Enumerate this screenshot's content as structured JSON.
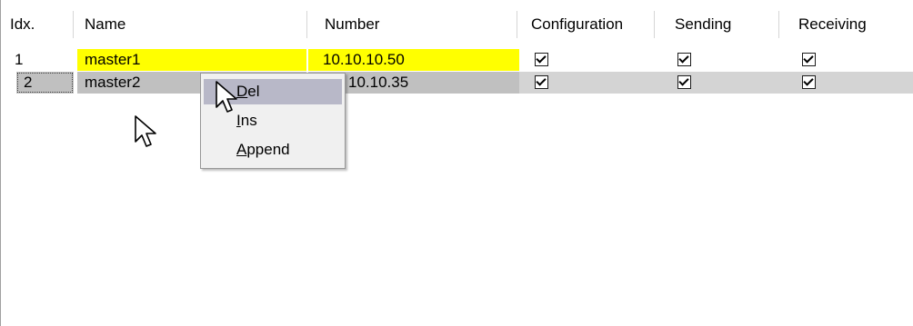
{
  "table": {
    "columns": {
      "idx": "Idx.",
      "name": "Name",
      "number": "Number",
      "configuration": "Configuration",
      "sending": "Sending",
      "receiving": "Receiving"
    },
    "rows": [
      {
        "idx": "1",
        "name": "master1",
        "number": "10.10.10.50",
        "configuration": true,
        "sending": true,
        "receiving": true
      },
      {
        "idx": "2",
        "name": "master2",
        "number": "10.10.35",
        "configuration": true,
        "sending": true,
        "receiving": true
      }
    ]
  },
  "context_menu": {
    "items": [
      {
        "label": "Del",
        "mnemonic": "D",
        "rest": "el"
      },
      {
        "label": "Ins",
        "mnemonic": "I",
        "rest": "ns"
      },
      {
        "label": "Append",
        "mnemonic": "A",
        "rest": "ppend"
      }
    ]
  },
  "colors": {
    "highlight_yellow": "#ffff00",
    "selected_row_gray": "#c0c0c0",
    "menu_hover": "#b8b8c8"
  },
  "icons": {
    "checkbox": "checked-checkbox-icon",
    "cursor": "mouse-pointer-icon"
  }
}
